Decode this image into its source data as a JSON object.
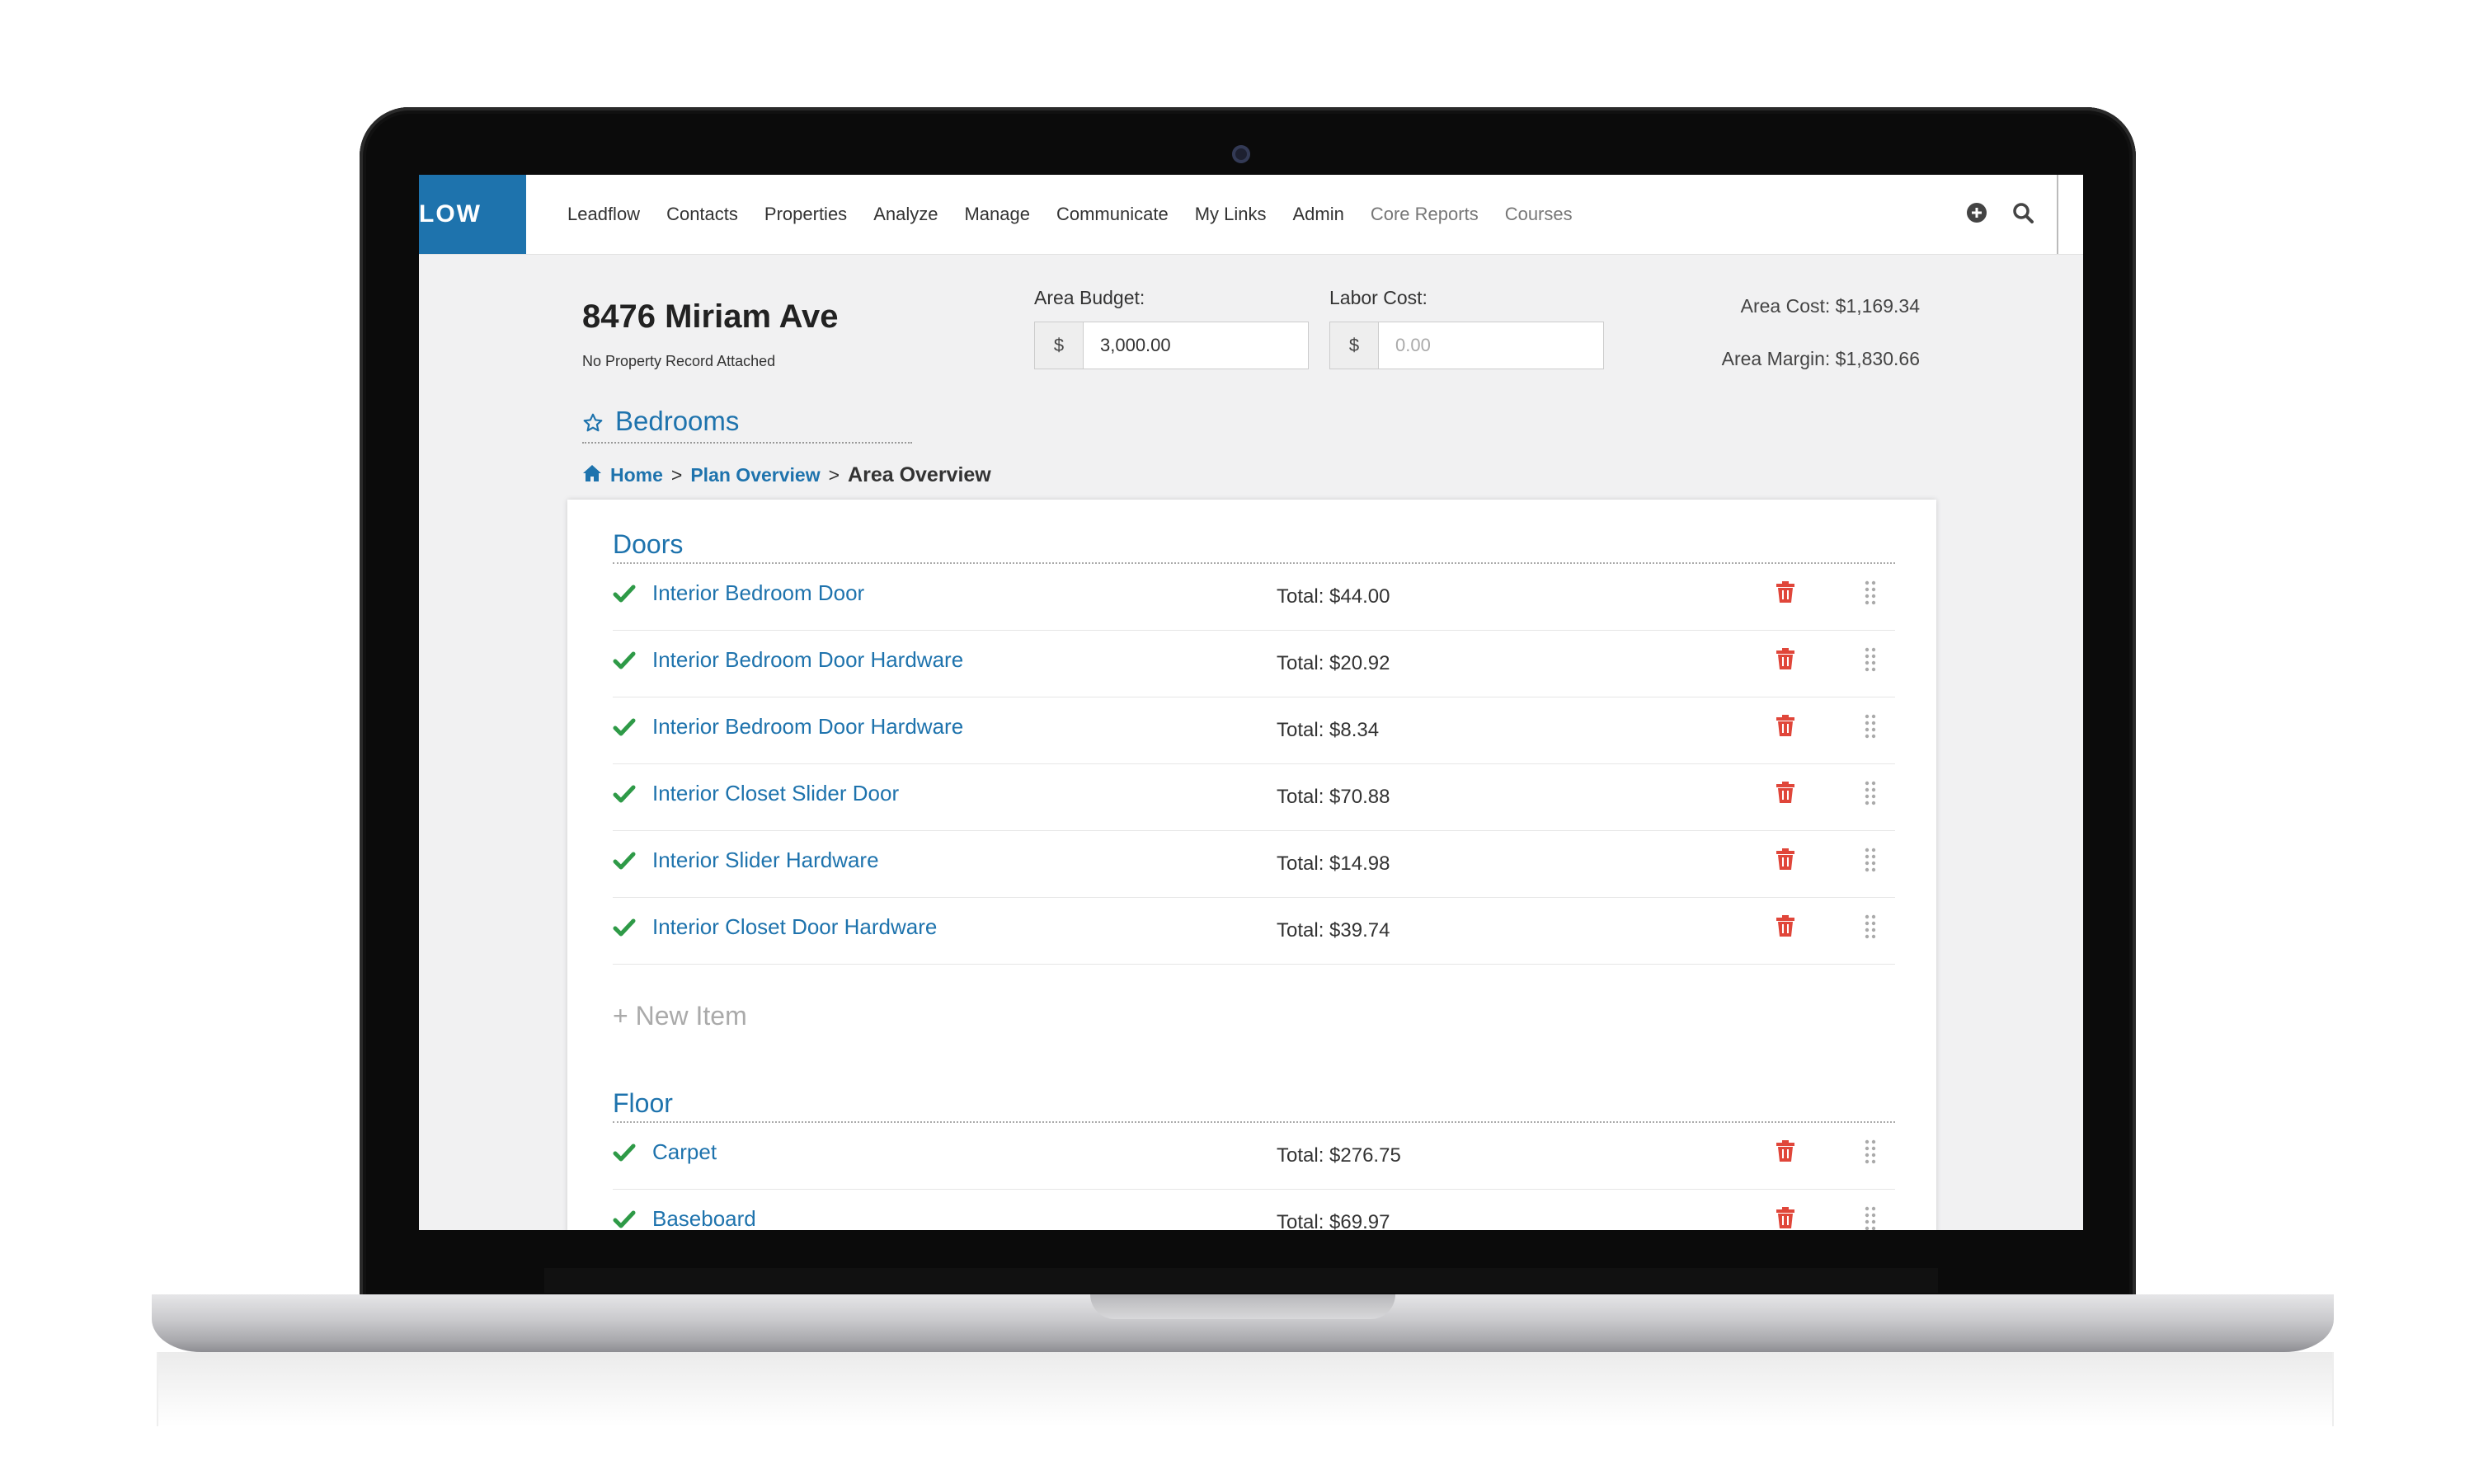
{
  "nav": {
    "logo": "LOW",
    "items": [
      "Leadflow",
      "Contacts",
      "Properties",
      "Analyze",
      "Manage",
      "Communicate",
      "My Links",
      "Admin",
      "Core Reports",
      "Courses"
    ]
  },
  "header": {
    "property_title": "8476 Miriam Ave",
    "property_subtitle": "No Property Record Attached",
    "area_budget_label": "Area Budget:",
    "area_budget_currency": "$",
    "area_budget_value": "3,000.00",
    "labor_cost_label": "Labor Cost:",
    "labor_cost_currency": "$",
    "labor_cost_placeholder": "0.00",
    "area_cost": "Area Cost: $1,169.34",
    "area_margin": "Area Margin: $1,830.66",
    "area_name": "Bedrooms"
  },
  "breadcrumb": {
    "home": "Home",
    "sep1": ">",
    "plan_overview": "Plan Overview",
    "sep2": ">",
    "current": "Area Overview"
  },
  "sections": [
    {
      "title": "Doors",
      "items": [
        {
          "name": "Interior Bedroom Door",
          "total": "Total: $44.00"
        },
        {
          "name": "Interior Bedroom Door Hardware",
          "total": "Total: $20.92"
        },
        {
          "name": "Interior Bedroom Door Hardware",
          "total": "Total: $8.34"
        },
        {
          "name": "Interior Closet Slider Door",
          "total": "Total: $70.88"
        },
        {
          "name": "Interior Slider Hardware",
          "total": "Total: $14.98"
        },
        {
          "name": "Interior Closet Door Hardware",
          "total": "Total: $39.74"
        }
      ],
      "new_item_label": "+ New Item"
    },
    {
      "title": "Floor",
      "items": [
        {
          "name": "Carpet",
          "total": "Total: $276.75"
        },
        {
          "name": "Baseboard",
          "total": "Total: $69.97"
        }
      ]
    }
  ],
  "colors": {
    "brand": "#1e73ad",
    "check": "#2e9a47",
    "trash": "#e0463a"
  }
}
